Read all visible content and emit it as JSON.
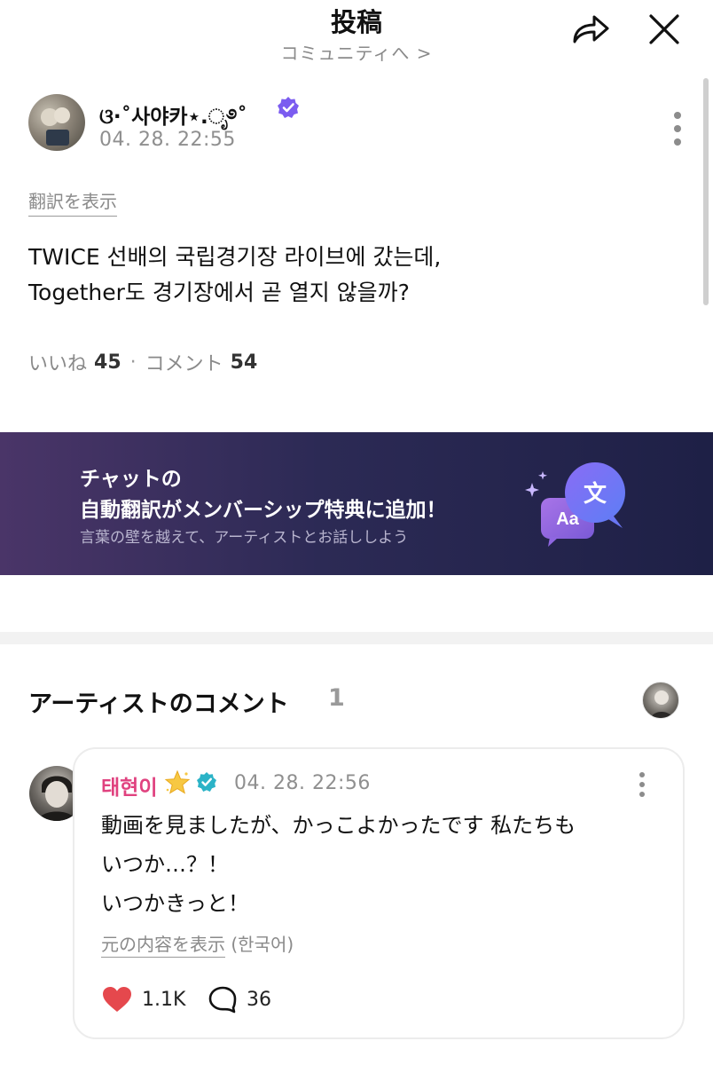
{
  "header": {
    "title": "投稿",
    "subtitle": "コミュニティへ >"
  },
  "post": {
    "author": "ଓ·˚사야카⋆.ೃ࿔˚",
    "date": "04. 28. 22:55",
    "translate_label": "翻訳を表示",
    "body": "TWICE 선배의 국립경기장 라이브에 갔는데,\nTogether도 경기장에서 곧 열지 않을까?",
    "likes_label": "いいね",
    "likes": "45",
    "separator": "·",
    "comments_label": "コメント",
    "comments": "54"
  },
  "banner": {
    "line1": "チャットの",
    "line2": "自動翻訳がメンバーシップ特典に追加！",
    "line3": "言葉の壁を越えて、アーティストとお話ししよう",
    "icon_text_fg": "文",
    "icon_text_bg": "Aa"
  },
  "artist_comments": {
    "title": "アーティストのコメント",
    "count": "1",
    "comment": {
      "name": "태현이",
      "date": "04. 28. 22:56",
      "text": "動画を見ましたが、かっこよかったです 私たちも\nいつか…？！\nいつかきっと！",
      "original_link": "元の内容を表示",
      "original_lang": "(한국어)",
      "likes": "1.1K",
      "replies": "36"
    }
  },
  "colors": {
    "accent_name": "#e0427f",
    "heart": "#e5484d",
    "verify_blue": "#2bb3c7",
    "verify_purple": "#7b5cf0",
    "banner_bg": "#2c2a55"
  },
  "icons": {
    "share": "share-icon",
    "close": "close-icon",
    "more": "more-vertical-icon",
    "verified": "verified-badge-icon",
    "star": "star-icon",
    "heart": "heart-icon",
    "reply": "reply-bubble-icon",
    "translate": "translate-icon"
  }
}
